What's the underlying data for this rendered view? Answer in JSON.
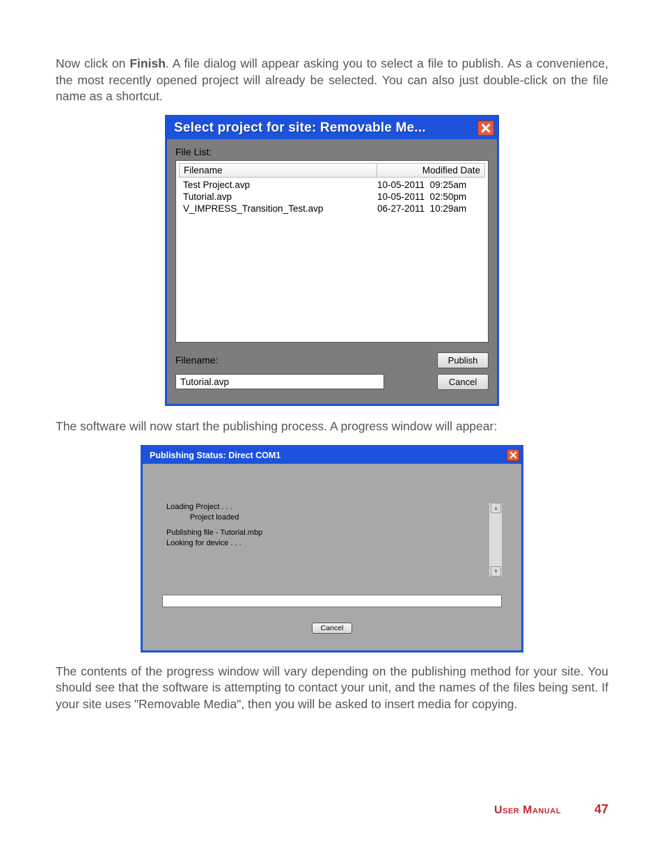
{
  "para1_a": "Now click on ",
  "para1_bold": "Finish",
  "para1_b": ". A file dialog will appear asking you to select a file to publish. As a convenience, the most recently opened project will already be selected. You can also just double-click on the file name as a shortcut.",
  "dialog1": {
    "title": "Select project for site: Removable Me...",
    "filelist_label": "File List:",
    "header_filename": "Filename",
    "header_modified": "Modified Date",
    "rows": [
      {
        "filename": "Test Project.avp",
        "modified": "10-05-2011  09:25am"
      },
      {
        "filename": "Tutorial.avp",
        "modified": "10-05-2011  02:50pm"
      },
      {
        "filename": "V_IMPRESS_Transition_Test.avp",
        "modified": "06-27-2011  10:29am"
      }
    ],
    "filename_label": "Filename:",
    "filename_value": "Tutorial.avp",
    "publish_btn": "Publish",
    "cancel_btn": "Cancel"
  },
  "para2": "The software will now start the publishing process. A progress window will appear:",
  "dialog2": {
    "title": "Publishing Status: Direct COM1",
    "msg1": "Loading Project . . .",
    "msg2": "Project loaded",
    "msg3": "Publishing file - Tutorial.mbp",
    "msg4": "Looking for device . . .",
    "cancel_btn": "Cancel"
  },
  "para3": "The contents of the progress window will vary depending on the publishing method for your site. You should see that the software is attempting to contact your unit, and the names of the files being sent. If your site uses \"Removable Media\", then you will be asked to insert media for copying.",
  "footer": {
    "label": "User Manual",
    "page": "47"
  }
}
